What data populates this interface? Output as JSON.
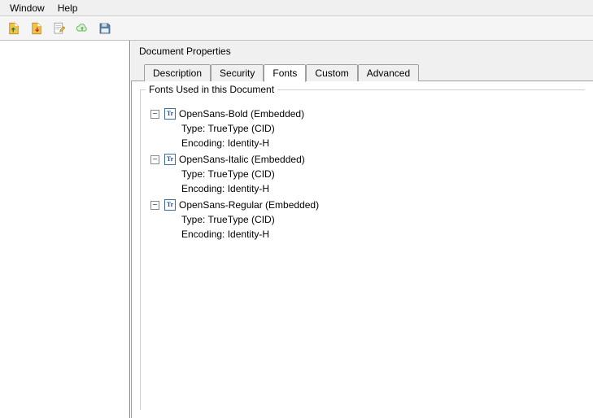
{
  "menubar": {
    "window": "Window",
    "help": "Help"
  },
  "dialog": {
    "title": "Document Properties",
    "tabs": {
      "description": "Description",
      "security": "Security",
      "fonts": "Fonts",
      "custom": "Custom",
      "advanced": "Advanced"
    },
    "group_title": "Fonts Used in this Document",
    "type_label_prefix": "Type: ",
    "encoding_label_prefix": "Encoding: ",
    "fonts_list": [
      {
        "name": "OpenSans-Bold (Embedded)",
        "type": "TrueType (CID)",
        "encoding": "Identity-H"
      },
      {
        "name": "OpenSans-Italic (Embedded)",
        "type": "TrueType (CID)",
        "encoding": "Identity-H"
      },
      {
        "name": "OpenSans-Regular (Embedded)",
        "type": "TrueType (CID)",
        "encoding": "Identity-H"
      }
    ],
    "font_icon_glyph": "Tr",
    "expander_glyph": "−"
  }
}
